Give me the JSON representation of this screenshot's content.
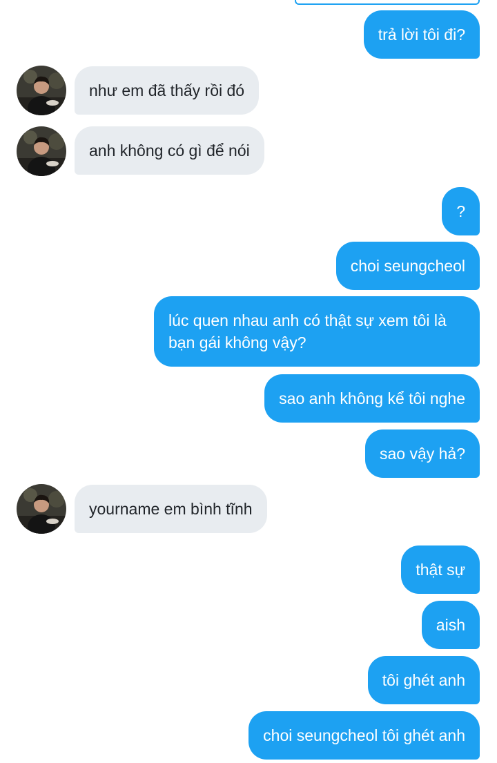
{
  "messages": [
    {
      "side": "sent",
      "text": "trả lời tôi đi?"
    },
    {
      "side": "recv",
      "text": "như em đã thấy rồi đó"
    },
    {
      "side": "recv",
      "text": "anh không có gì để nói"
    },
    {
      "side": "sent",
      "text": "?"
    },
    {
      "side": "sent",
      "text": "choi seungcheol"
    },
    {
      "side": "sent",
      "text": "lúc quen nhau anh có thật sự xem tôi là bạn gái không vậy?"
    },
    {
      "side": "sent",
      "text": "sao anh không kể tôi nghe"
    },
    {
      "side": "sent",
      "text": "sao vậy hả?"
    },
    {
      "side": "recv",
      "text": "yourname em bình tĩnh"
    },
    {
      "side": "sent",
      "text": "thật sự"
    },
    {
      "side": "sent",
      "text": "aish"
    },
    {
      "side": "sent",
      "text": "tôi ghét anh"
    },
    {
      "side": "sent",
      "text": "choi seungcheol tôi ghét anh"
    }
  ],
  "colors": {
    "sent_bubble": "#1da1f2",
    "recv_bubble": "#e8ecf0"
  },
  "icons": {
    "avatar": "user-avatar-photo"
  }
}
